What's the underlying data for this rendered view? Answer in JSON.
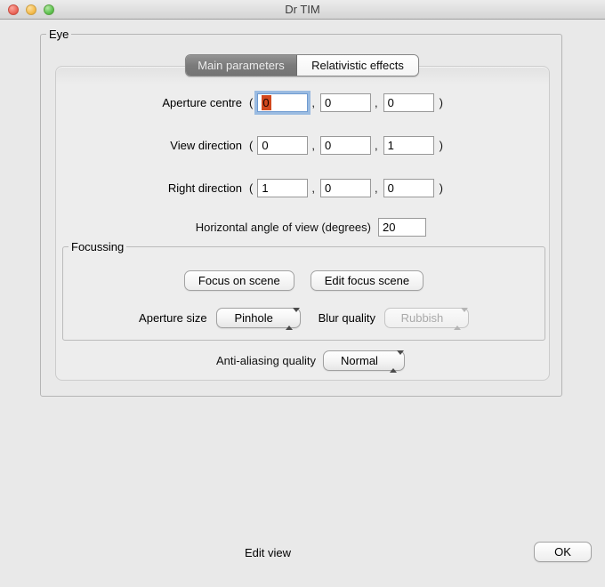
{
  "window": {
    "title": "Dr TIM"
  },
  "colors": {
    "focus_ring": "#7daadc",
    "text_selection": "#d2481e",
    "selected_tab_bg": "#7b7b7b",
    "close_button": "#ec6a5e",
    "minimize_button": "#f5bd4f",
    "zoom_button": "#61c454",
    "window_background": "#e9e9e9"
  },
  "eye_group": {
    "label": "Eye"
  },
  "tabs": [
    {
      "label": "Main parameters",
      "selected": true
    },
    {
      "label": "Relativistic effects",
      "selected": false
    }
  ],
  "punctuation": {
    "open_paren": "(",
    "comma": ",",
    "close_paren": ")"
  },
  "vector_rows": [
    {
      "label": "Aperture centre",
      "values": [
        "0",
        "0",
        "0"
      ],
      "first_field_focused": true,
      "first_value_selected": true
    },
    {
      "label": "View direction",
      "values": [
        "0",
        "0",
        "1"
      ]
    },
    {
      "label": "Right direction",
      "values": [
        "1",
        "0",
        "0"
      ]
    }
  ],
  "angle_row": {
    "label": "Horizontal angle of view (degrees)",
    "value": "20"
  },
  "focussing": {
    "label": "Focussing",
    "focus_button": "Focus on scene",
    "edit_button": "Edit focus scene",
    "aperture_size_label": "Aperture size",
    "aperture_size_value": "Pinhole",
    "blur_quality_label": "Blur quality",
    "blur_quality_value": "Rubbish",
    "blur_quality_disabled": true
  },
  "anti_aliasing": {
    "label": "Anti-aliasing quality",
    "value": "Normal"
  },
  "footer": {
    "edit_view_label": "Edit view",
    "ok_button": "OK"
  }
}
